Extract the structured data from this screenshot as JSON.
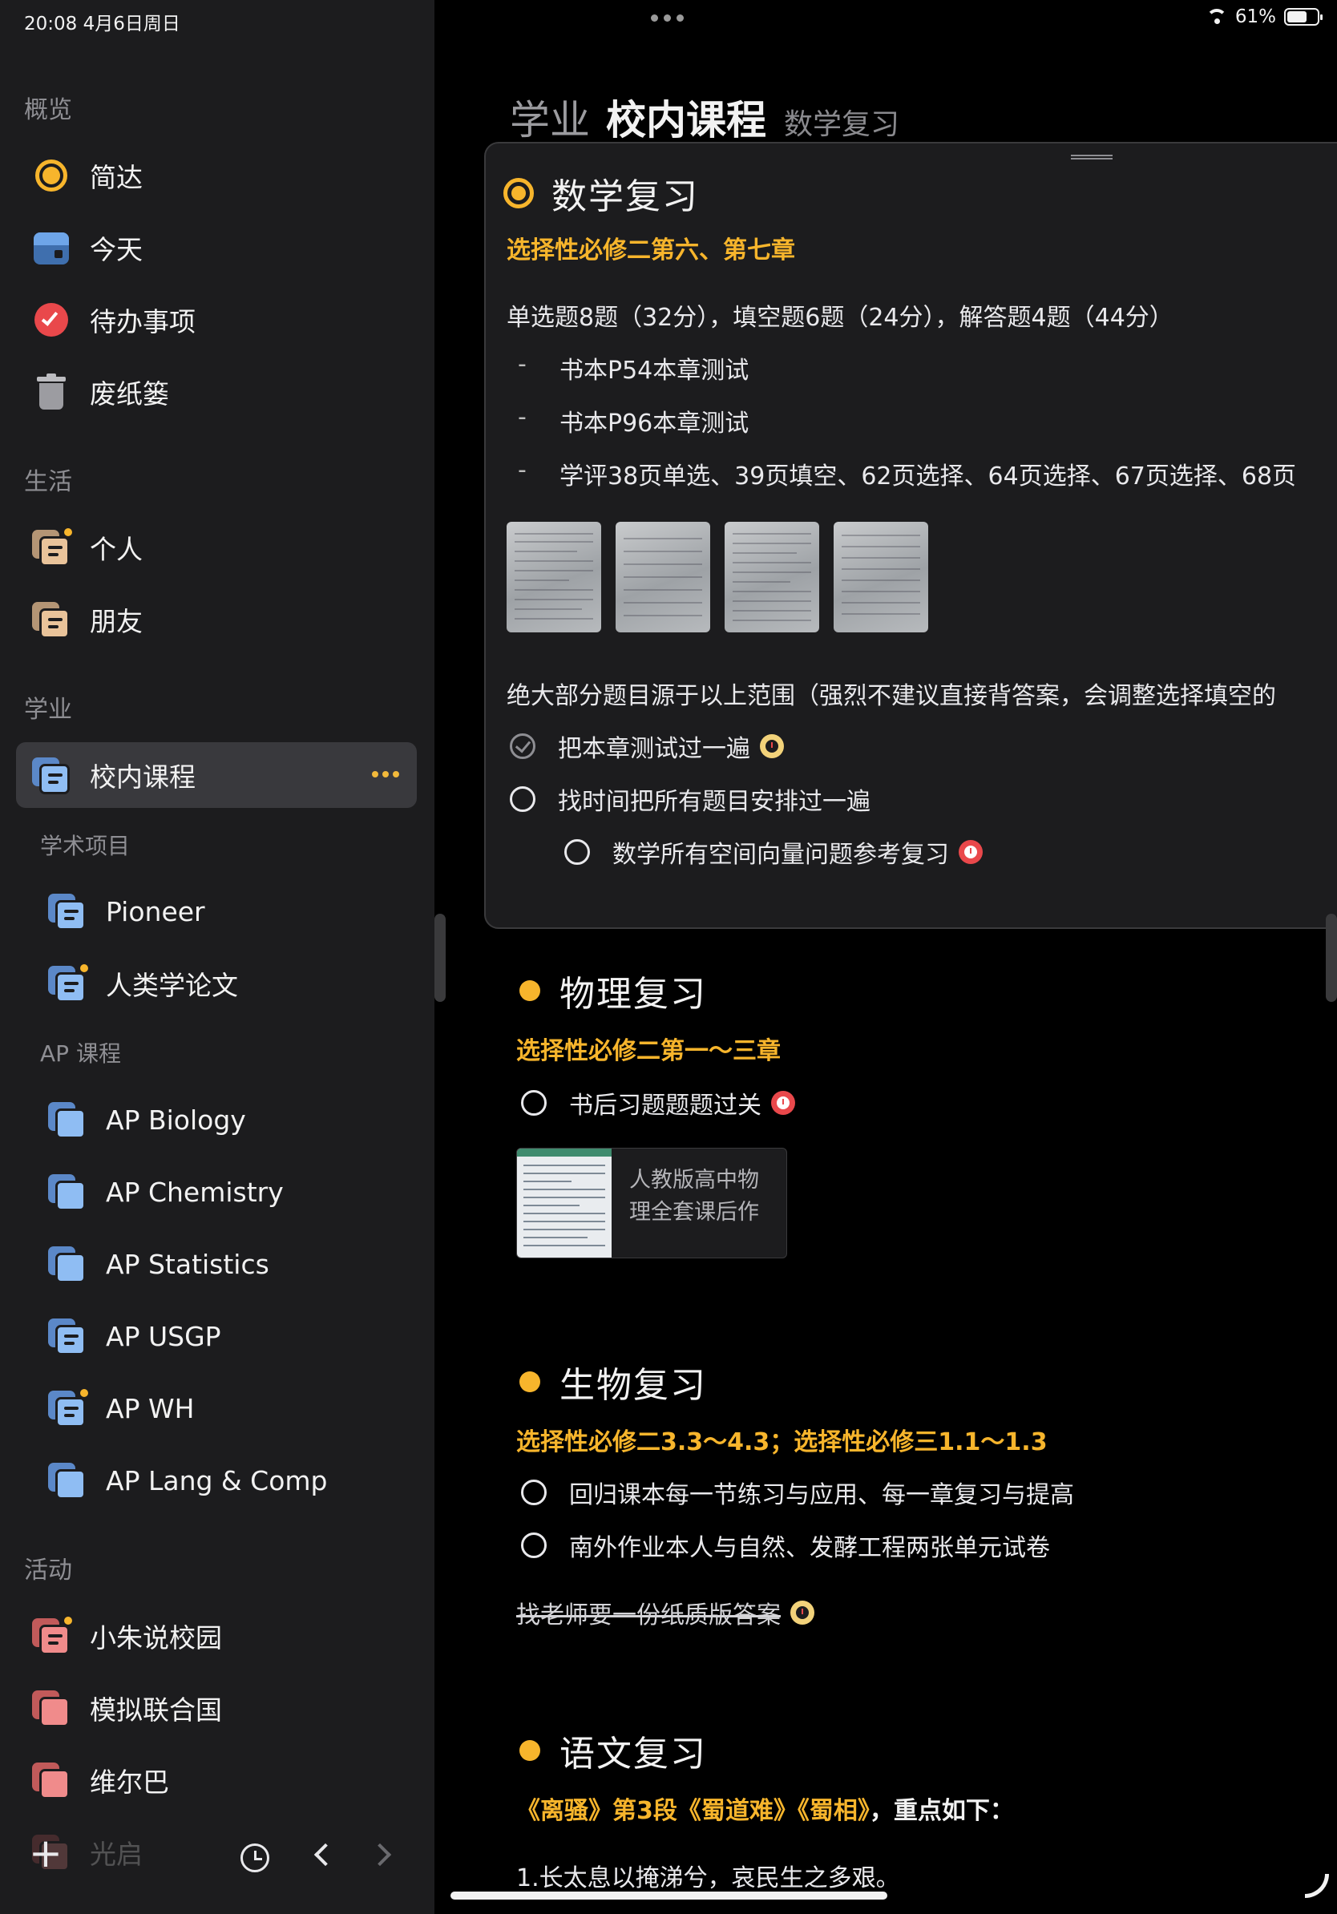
{
  "status": {
    "time_date": "20:08   4月6日周日",
    "battery": "61%"
  },
  "sidebar": {
    "sections": {
      "overview": "概览",
      "life": "生活",
      "study": "学业",
      "academic_projects": "学术项目",
      "ap_courses": "AP 课程",
      "activities": "活动"
    },
    "items": [
      {
        "label": "简达",
        "icon": "focus-icon"
      },
      {
        "label": "今天",
        "icon": "calendar-icon"
      },
      {
        "label": "待办事项",
        "icon": "checkmark-icon"
      },
      {
        "label": "废纸篓",
        "icon": "trash-icon"
      },
      {
        "label": "个人",
        "icon": "list-icon"
      },
      {
        "label": "朋友",
        "icon": "list-icon"
      },
      {
        "label": "校内课程",
        "icon": "list-icon",
        "selected": true
      },
      {
        "label": "Pioneer",
        "icon": "list-icon"
      },
      {
        "label": "人类学论文",
        "icon": "list-icon"
      },
      {
        "label": "AP Biology",
        "icon": "list-icon"
      },
      {
        "label": "AP Chemistry",
        "icon": "list-icon"
      },
      {
        "label": "AP Statistics",
        "icon": "list-icon"
      },
      {
        "label": "AP USGP",
        "icon": "list-icon"
      },
      {
        "label": "AP WH",
        "icon": "list-icon"
      },
      {
        "label": "AP Lang & Comp",
        "icon": "list-icon"
      },
      {
        "label": "小朱说校园",
        "icon": "list-icon"
      },
      {
        "label": "模拟联合国",
        "icon": "list-icon"
      },
      {
        "label": "维尔巴",
        "icon": "list-icon"
      },
      {
        "label": "光启",
        "icon": "list-icon"
      }
    ]
  },
  "header": {
    "crumb1": "学业",
    "crumb2": "校内课程",
    "crumb3": "数学复习"
  },
  "math": {
    "title": "数学复习",
    "highlight": "选择性必修二第六、第七章",
    "summary": "单选题8题（32分），填空题6题（24分），解答题4题（44分）",
    "bullets": [
      "书本P54本章测试",
      "书本P96本章测试",
      "学评38页单选、39页填空、62页选择、64页选择、67页选择、68页"
    ],
    "note": "绝大部分题目源于以上范围（强烈不建议直接背答案，会调整选择填空的",
    "todos": [
      {
        "text": "把本章测试过一遍",
        "done": true
      },
      {
        "text": "找时间把所有题目安排过一遍",
        "done": false
      },
      {
        "text": "数学所有空间向量问题参考复习",
        "done": false
      }
    ]
  },
  "physics": {
    "title": "物理复习",
    "highlight": "选择性必修二第一～三章",
    "todo": "书后习题题题过关",
    "attachment": "人教版高中物理全套课后作"
  },
  "biology": {
    "title": "生物复习",
    "highlight": "选择性必修二3.3～4.3；选择性必修三1.1～1.3",
    "todos": [
      "回归课本每一节练习与应用、每一章复习与提高",
      "南外作业本人与自然、发酵工程两张单元试卷"
    ],
    "struck": "找老师要一份纸质版答案"
  },
  "chinese": {
    "title": "语文复习",
    "highlight": "《离骚》第3段《蜀道难》《蜀相》",
    "highlight_tail": "，重点如下：",
    "line1": "1.长太息以掩涕兮，哀民生之多艰。"
  },
  "colors": {
    "accent": "#f7b52c",
    "sidebar": "#1c1c1e",
    "background": "#000000"
  }
}
